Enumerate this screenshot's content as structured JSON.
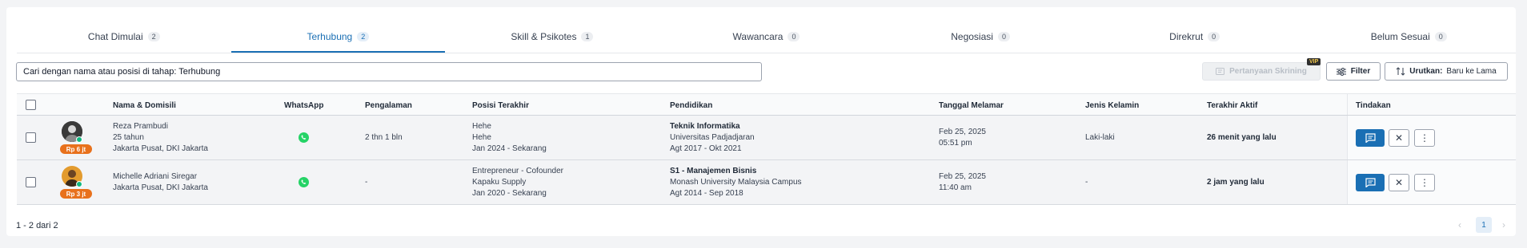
{
  "tabs": [
    {
      "label": "Chat Dimulai",
      "count": "2"
    },
    {
      "label": "Terhubung",
      "count": "2"
    },
    {
      "label": "Skill & Psikotes",
      "count": "1"
    },
    {
      "label": "Wawancara",
      "count": "0"
    },
    {
      "label": "Negosiasi",
      "count": "0"
    },
    {
      "label": "Direkrut",
      "count": "0"
    },
    {
      "label": "Belum Sesuai",
      "count": "0"
    }
  ],
  "active_tab": "Terhubung",
  "search": {
    "value": "Cari dengan nama atau posisi di tahap: Terhubung"
  },
  "toolbar": {
    "screening_label": "Pertanyaan Skrining",
    "vip_badge": "VIP",
    "filter_label": "Filter",
    "sort_label": "Urutkan:",
    "sort_value": "Baru ke Lama"
  },
  "table": {
    "headers": {
      "name": "Nama & Domisili",
      "whatsapp": "WhatsApp",
      "experience": "Pengalaman",
      "position": "Posisi Terakhir",
      "education": "Pendidikan",
      "applied": "Tanggal Melamar",
      "gender": "Jenis Kelamin",
      "last_active": "Terakhir Aktif",
      "actions": "Tindakan"
    },
    "rows": [
      {
        "salary": "Rp 6 jt",
        "name": "Reza Prambudi",
        "age": "25 tahun",
        "location": "Jakarta Pusat, DKI Jakarta",
        "experience": "2 thn 1 bln",
        "position_title": "Hehe",
        "position_company": "Hehe",
        "position_period": "Jan 2024 - Sekarang",
        "edu_major": "Teknik Informatika",
        "edu_school": "Universitas Padjadjaran",
        "edu_period": "Agt 2017 - Okt 2021",
        "applied_date": "Feb 25, 2025",
        "applied_time": "05:51 pm",
        "gender": "Laki-laki",
        "last_active": "26 menit yang lalu"
      },
      {
        "salary": "Rp 3 jt",
        "name": "Michelle Adriani Siregar",
        "location": "Jakarta Pusat, DKI Jakarta",
        "experience": "-",
        "position_title": "Entrepreneur - Cofounder",
        "position_company": "Kapaku Supply",
        "position_period": "Jan 2020 - Sekarang",
        "edu_major": "S1 - Manajemen Bisnis",
        "edu_school": "Monash University Malaysia Campus",
        "edu_period": "Agt 2014 - Sep 2018",
        "applied_date": "Feb 25, 2025",
        "applied_time": "11:40 am",
        "gender": "-",
        "last_active": "2 jam yang lalu"
      }
    ]
  },
  "pagination": {
    "summary": "1 - 2 dari 2",
    "current_page": "1"
  },
  "colors": {
    "primary": "#1a6fb4",
    "salary_badge": "#e8711c",
    "online": "#10b981",
    "whatsapp": "#25d366"
  }
}
